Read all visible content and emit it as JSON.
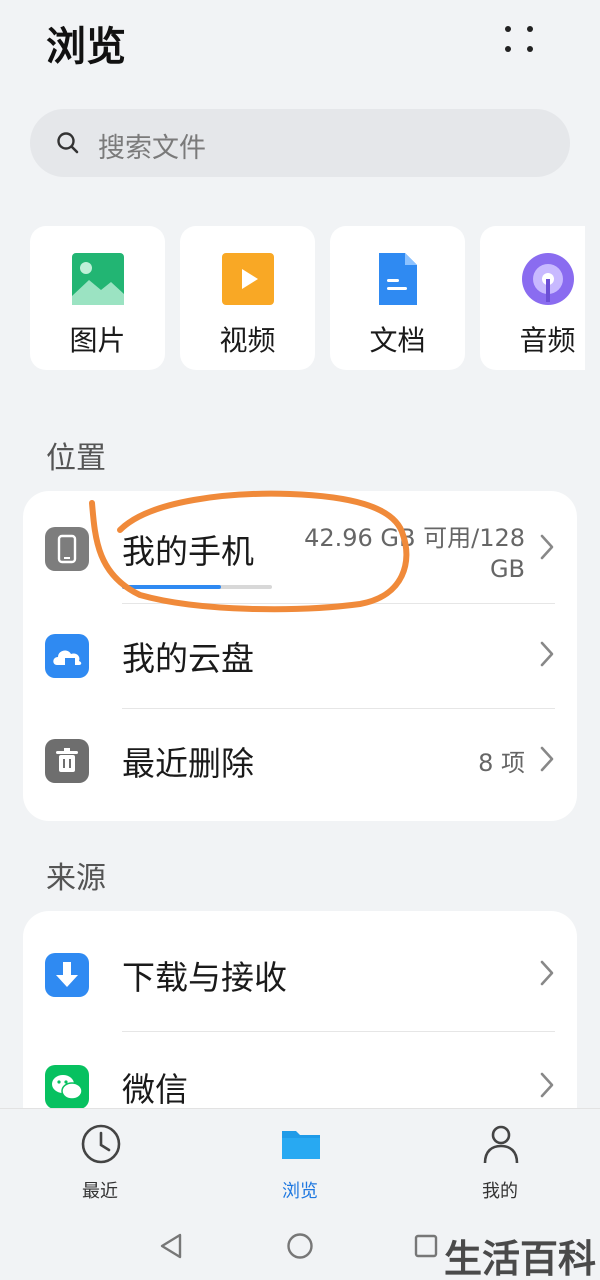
{
  "header": {
    "title": "浏览"
  },
  "search": {
    "placeholder": "搜索文件"
  },
  "categories": [
    {
      "label": "图片",
      "icon": "image-icon",
      "color": "#22b573"
    },
    {
      "label": "视频",
      "icon": "video-icon",
      "color": "#f9a825"
    },
    {
      "label": "文档",
      "icon": "document-icon",
      "color": "#2f8af2"
    },
    {
      "label": "音频",
      "icon": "audio-icon",
      "color": "#8a6cf0"
    }
  ],
  "locations": {
    "label": "位置",
    "items": [
      {
        "label": "我的手机",
        "value": "42.96 GB 可用/128 GB",
        "value_line1": "42.96 GB 可用/128",
        "value_line2": "GB",
        "icon": "phone-icon",
        "storage_used_fraction": 0.66
      },
      {
        "label": "我的云盘",
        "icon": "cloud-drive-icon"
      },
      {
        "label": "最近删除",
        "value": "8 项",
        "icon": "trash-icon"
      }
    ]
  },
  "sources": {
    "label": "来源",
    "items": [
      {
        "label": "下载与接收",
        "icon": "download-icon"
      },
      {
        "label": "微信",
        "icon": "wechat-icon"
      }
    ]
  },
  "bottom_nav": [
    {
      "label": "最近",
      "icon": "clock-icon",
      "active": false
    },
    {
      "label": "浏览",
      "icon": "folder-icon",
      "active": true
    },
    {
      "label": "我的",
      "icon": "person-icon",
      "active": false
    }
  ],
  "watermark": "生活百科",
  "colors": {
    "accent": "#2f8af2",
    "background": "#f1f3f5",
    "card": "#ffffff",
    "annotation": "#f08a3a"
  }
}
